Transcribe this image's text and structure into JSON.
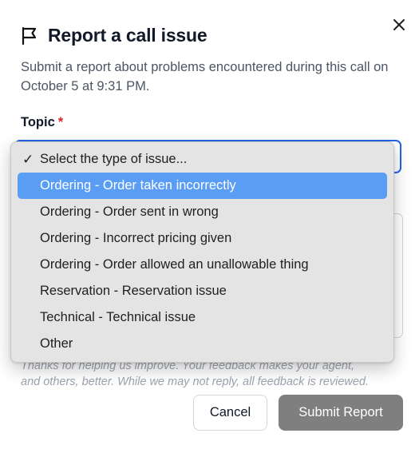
{
  "dialog": {
    "title": "Report a call issue",
    "subtitle": "Submit a report about problems encountered during this call on October 5 at 9:31 PM.",
    "close_icon": "close-icon",
    "flag_icon": "flag-icon"
  },
  "form": {
    "topic_label": "Topic",
    "required_marker": "*",
    "footnote_line1": "Thanks for helping us improve. Your feedback makes your agent,",
    "footnote_line2": "and others, better. While we may not reply, all feedback is reviewed."
  },
  "dropdown": {
    "selected_value": "Select the type of issue...",
    "highlighted_index": 1,
    "options": [
      {
        "label": "Select the type of issue...",
        "checked": true
      },
      {
        "label": "Ordering - Order taken incorrectly",
        "checked": false
      },
      {
        "label": "Ordering - Order sent in wrong",
        "checked": false
      },
      {
        "label": "Ordering - Incorrect pricing given",
        "checked": false
      },
      {
        "label": "Ordering - Order allowed an unallowable thing",
        "checked": false
      },
      {
        "label": "Reservation - Reservation issue",
        "checked": false
      },
      {
        "label": "Technical - Technical issue",
        "checked": false
      },
      {
        "label": "Other",
        "checked": false
      }
    ],
    "check_glyph": "✓"
  },
  "buttons": {
    "cancel_label": "Cancel",
    "submit_label": "Submit Report"
  },
  "colors": {
    "highlight": "#5a9df5",
    "focus_border": "#2563eb",
    "submit_bg": "#7f7f7f",
    "required": "#dc2626"
  }
}
